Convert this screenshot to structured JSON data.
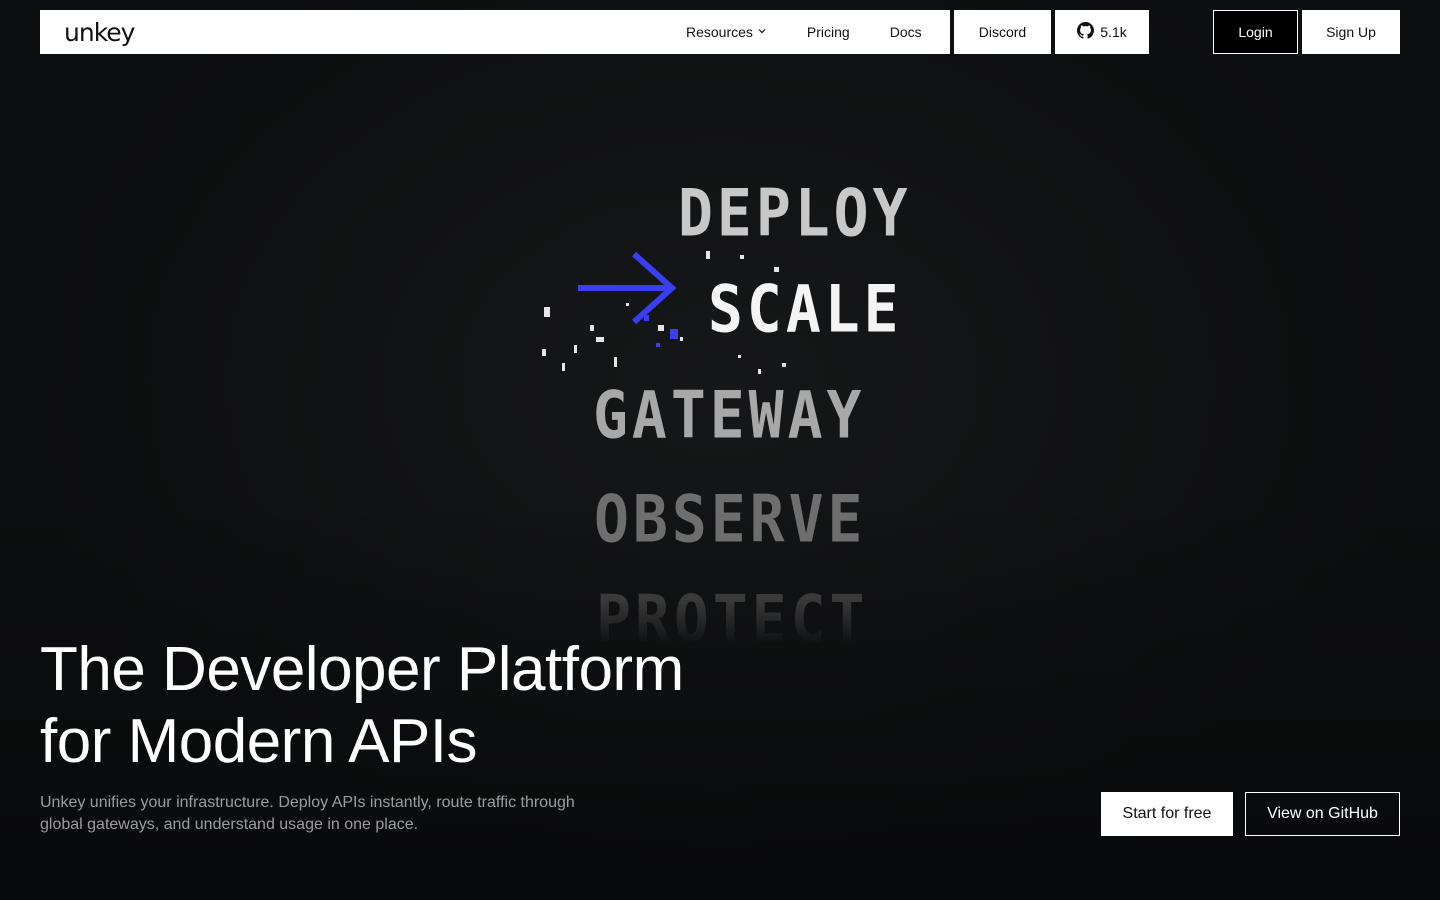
{
  "nav": {
    "logo": "unkey",
    "links": [
      {
        "label": "Resources"
      },
      {
        "label": "Pricing"
      },
      {
        "label": "Docs"
      }
    ],
    "discord": "Discord",
    "github_stars": "5.1k",
    "login": "Login",
    "signup": "Sign Up"
  },
  "hero": {
    "words": [
      "DEPLOY",
      "SCALE",
      "GATEWAY",
      "OBSERVE",
      "PROTECT"
    ],
    "headline_line1": "The Developer Platform",
    "headline_line2": "for Modern APIs",
    "subline": "Unkey unifies your infrastructure. Deploy APIs instantly, route traffic through global gateways, and understand usage in one place.",
    "cta_primary": "Start for free",
    "cta_secondary": "View on GitHub"
  },
  "colors": {
    "background": "#101112",
    "accent_arrow": "#3a3df0",
    "nav_bg": "#ffffff"
  }
}
